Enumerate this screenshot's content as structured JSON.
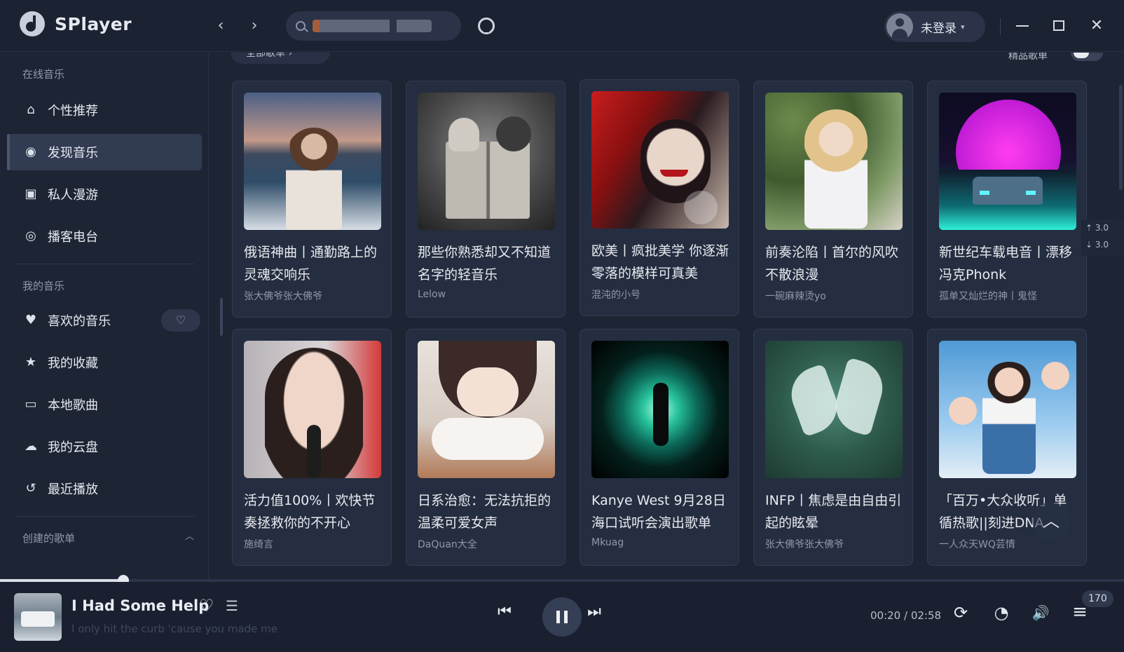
{
  "app": {
    "name": "SPlayer"
  },
  "header": {
    "back_glyph": "‹",
    "forward_glyph": "›",
    "user_label": "未登录",
    "caret": "▾",
    "min_label": "",
    "close_glyph": "✕"
  },
  "sidebar": {
    "online_section": "在线音乐",
    "online_items": [
      {
        "label": "个性推荐",
        "icon": "home-icon",
        "glyph": "⌂"
      },
      {
        "label": "发现音乐",
        "icon": "compass-icon",
        "glyph": "◉"
      },
      {
        "label": "私人漫游",
        "icon": "radio-icon",
        "glyph": "▣"
      },
      {
        "label": "播客电台",
        "icon": "podcast-icon",
        "glyph": "◎"
      }
    ],
    "my_section": "我的音乐",
    "my_items": [
      {
        "label": "喜欢的音乐",
        "icon": "heart-icon",
        "glyph": "♥"
      },
      {
        "label": "我的收藏",
        "icon": "star-icon",
        "glyph": "★"
      },
      {
        "label": "本地歌曲",
        "icon": "folder-icon",
        "glyph": "▭"
      },
      {
        "label": "我的云盘",
        "icon": "cloud-icon",
        "glyph": "☁"
      },
      {
        "label": "最近播放",
        "icon": "history-icon",
        "glyph": "↺"
      }
    ],
    "heart_mode_glyph": "♡",
    "created_section": "创建的歌单",
    "collapse_glyph": "︿"
  },
  "main": {
    "all_playlists_chip": "全部歌单 ›",
    "quality_label": "精品歌单",
    "playlists": [
      {
        "title": "俄语神曲丨通勤路上的灵魂交响乐",
        "author": "张大佛爷张大佛爷"
      },
      {
        "title": "那些你熟悉却又不知道名字的轻音乐",
        "author": "Lelow"
      },
      {
        "title": "欧美丨疯批美学 你逐渐零落的模样可真美",
        "author": "混沌的小号"
      },
      {
        "title": "前奏沦陷丨首尔的风吹不散浪漫",
        "author": "一碗麻辣烫yo"
      },
      {
        "title": "新世纪车载电音丨漂移冯克Phonk",
        "author": "孤单又灿烂的神丨鬼怪"
      },
      {
        "title": "活力值100%丨欢快节奏拯救你的不开心",
        "author": "施绮言"
      },
      {
        "title": "日系治愈：无法抗拒的温柔可爱女声",
        "author": "DaQuan大全"
      },
      {
        "title": "Kanye West 9月28日海口试听会演出歌单",
        "author": "Mkuag"
      },
      {
        "title": "INFP丨焦虑是由自由引起的眩晕",
        "author": "张大佛爷张大佛爷"
      },
      {
        "title": "「百万•大众收听」单循热歌||刻进DNA",
        "author": "一人众天WQ芸情"
      }
    ],
    "scroll_top_glyph": "︿",
    "net_up": "3.0",
    "net_down": "3.0",
    "net_up_glyph": "⇡",
    "net_down_glyph": "⇣"
  },
  "player": {
    "song_title": "I Had Some Help",
    "lyric": "I only hit the curb 'cause you made me",
    "current_time": "00:20",
    "duration": "02:58",
    "time_display": "00:20 / 02:58",
    "progress_fraction": 0.11,
    "queue_count": "170",
    "like_glyph": "♡",
    "list_glyph": "☰",
    "prev_glyph": "⏮",
    "next_glyph": "⏭",
    "repeat_glyph": "⟳",
    "speed_glyph": "◔",
    "volume_glyph": "🔊",
    "queue_glyph": "≡"
  },
  "colors": {
    "background": "#1d2535",
    "card": "#252e40",
    "accent": "#313b52",
    "text": "#e4e8f0"
  }
}
